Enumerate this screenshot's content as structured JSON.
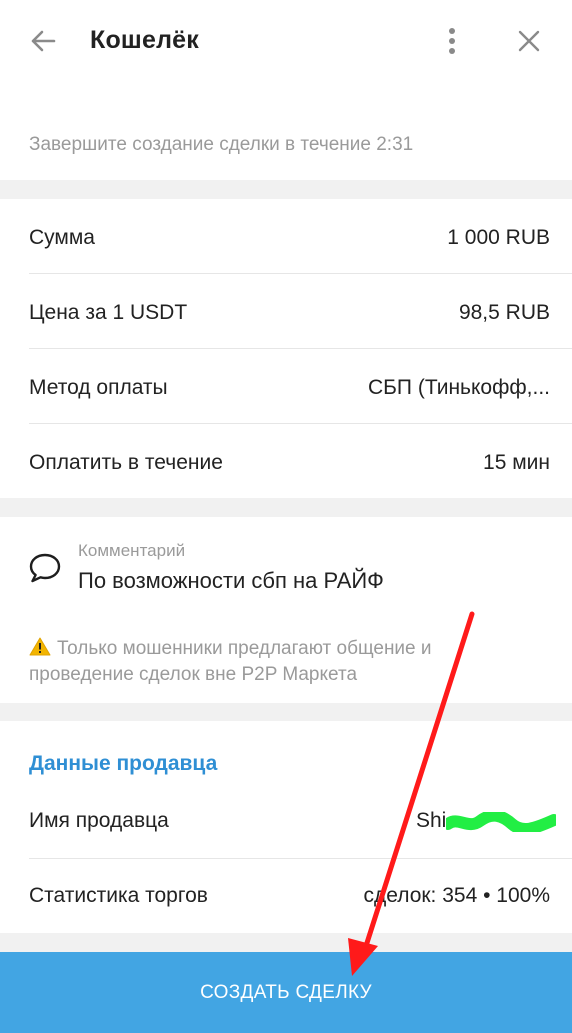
{
  "header": {
    "title": "Кошелёк",
    "back_icon": "arrow-left-icon",
    "menu_icon": "more-vertical-icon",
    "close_icon": "close-icon"
  },
  "timer": {
    "text": "Завершите создание сделки в течение 2:31"
  },
  "details": {
    "rows": [
      {
        "label": "Сумма",
        "value": "1 000 RUB"
      },
      {
        "label": "Цена за 1 USDT",
        "value": "98,5 RUB"
      },
      {
        "label": "Метод оплаты",
        "value": "СБП (Тинькофф,..."
      },
      {
        "label": "Оплатить в течение",
        "value": "15 мин"
      }
    ]
  },
  "comment": {
    "icon": "speech-bubble-icon",
    "label": "Комментарий",
    "text": "По возможности сбп на РАЙФ"
  },
  "warning": {
    "icon": "warning-icon",
    "text": "Только мошенники предлагают общение и проведение сделок вне P2P Маркета"
  },
  "seller": {
    "title": "Данные продавца",
    "rows": [
      {
        "label": "Имя продавца",
        "value": "Shi"
      },
      {
        "label": "Статистика торгов",
        "value": "сделок: 354 • 100%"
      }
    ]
  },
  "action": {
    "create_label": "СОЗДАТЬ СДЕЛКУ"
  },
  "colors": {
    "accent": "#42a5e3",
    "link": "#2f8fd4",
    "annotation_arrow": "#ff1a1a",
    "redaction_scribble": "#22ee44"
  }
}
